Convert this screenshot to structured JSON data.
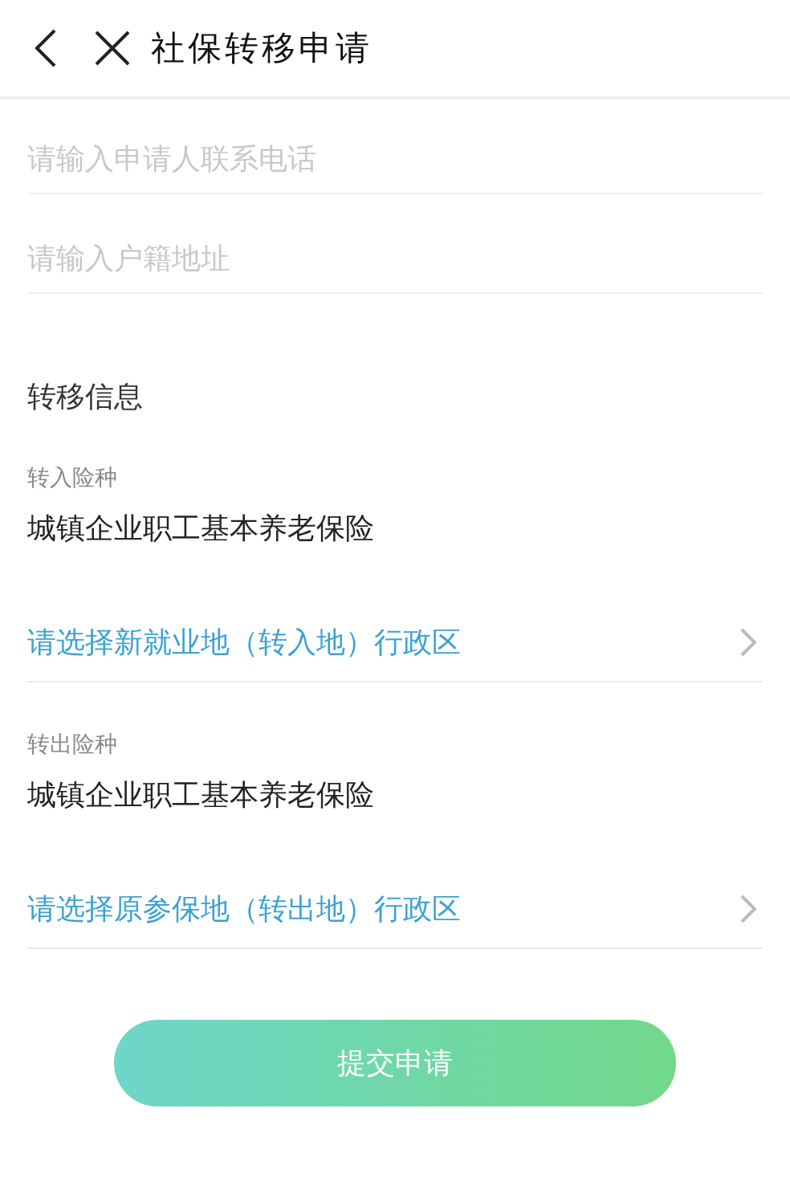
{
  "header": {
    "title": "社保转移申请"
  },
  "fields": [
    {
      "placeholder": "请输入申请人联系电话"
    },
    {
      "placeholder": "请输入户籍地址"
    }
  ],
  "section_title": "转移信息",
  "groups": [
    {
      "label": "转入险种",
      "value": "城镇企业职工基本养老保险",
      "selector": "请选择新就业地（转入地）行政区"
    },
    {
      "label": "转出险种",
      "value": "城镇企业职工基本养老保险",
      "selector": "请选择原参保地（转出地）行政区"
    }
  ],
  "submit_button": "提交申请"
}
